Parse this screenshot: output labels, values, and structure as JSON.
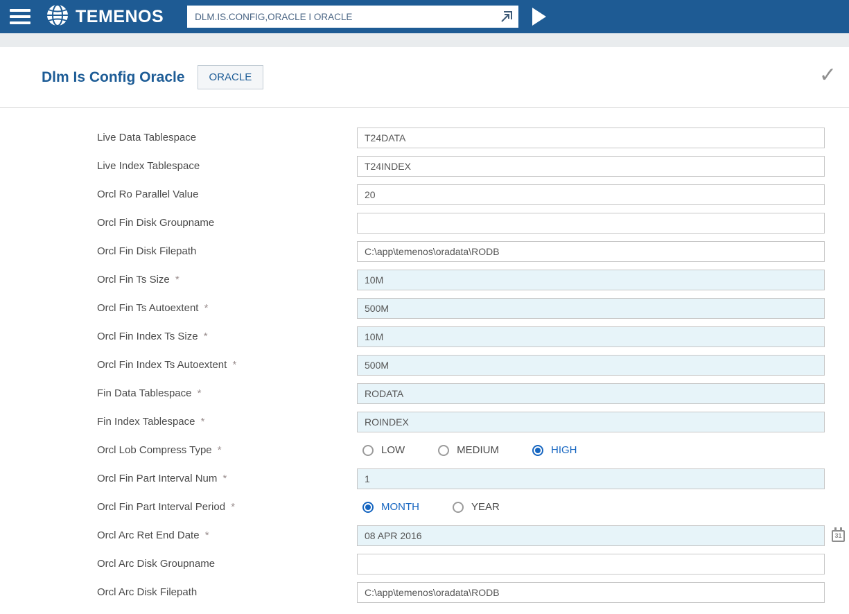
{
  "topbar": {
    "brand": "TEMENOS",
    "command": {
      "value": "DLM.IS.CONFIG,ORACLE I ORACLE"
    }
  },
  "page": {
    "title": "Dlm Is Config Oracle",
    "badge": "ORACLE"
  },
  "icons": {
    "check": "✓",
    "calendar_day": "31"
  },
  "colors": {
    "topbar_blue": "#1e5b94",
    "title_blue": "#1d5c96",
    "radio_blue": "#1565c0",
    "required_field_bg": "#e7f4f9"
  },
  "form": {
    "fields": [
      {
        "label": "Live Data Tablespace",
        "required": false,
        "type": "text",
        "value": "T24DATA",
        "highlight": false
      },
      {
        "label": "Live Index Tablespace",
        "required": false,
        "type": "text",
        "value": "T24INDEX",
        "highlight": false
      },
      {
        "label": "Orcl Ro Parallel Value",
        "required": false,
        "type": "text",
        "value": "20",
        "highlight": false
      },
      {
        "label": "Orcl Fin Disk Groupname",
        "required": false,
        "type": "text",
        "value": "",
        "highlight": false
      },
      {
        "label": "Orcl Fin Disk Filepath",
        "required": false,
        "type": "text",
        "value": "C:\\app\\temenos\\oradata\\RODB",
        "highlight": false
      },
      {
        "label": "Orcl Fin Ts Size",
        "required": true,
        "type": "text",
        "value": "10M",
        "highlight": true
      },
      {
        "label": "Orcl Fin Ts Autoextent",
        "required": true,
        "type": "text",
        "value": "500M",
        "highlight": true
      },
      {
        "label": "Orcl Fin Index Ts Size",
        "required": true,
        "type": "text",
        "value": "10M",
        "highlight": true
      },
      {
        "label": "Orcl Fin Index Ts Autoextent",
        "required": true,
        "type": "text",
        "value": "500M",
        "highlight": true
      },
      {
        "label": "Fin Data Tablespace",
        "required": true,
        "type": "text",
        "value": "RODATA",
        "highlight": true
      },
      {
        "label": "Fin Index Tablespace",
        "required": true,
        "type": "text",
        "value": "ROINDEX",
        "highlight": true
      },
      {
        "label": "Orcl Lob Compress Type",
        "required": true,
        "type": "radio",
        "options": [
          {
            "label": "LOW",
            "selected": false
          },
          {
            "label": "MEDIUM",
            "selected": false
          },
          {
            "label": "HIGH",
            "selected": true
          }
        ]
      },
      {
        "label": "Orcl Fin Part Interval Num",
        "required": true,
        "type": "text",
        "value": "1",
        "highlight": true
      },
      {
        "label": "Orcl Fin Part Interval Period",
        "required": true,
        "type": "radio",
        "options": [
          {
            "label": "MONTH",
            "selected": true
          },
          {
            "label": "YEAR",
            "selected": false
          }
        ]
      },
      {
        "label": "Orcl Arc Ret End Date",
        "required": true,
        "type": "text",
        "value": "08 APR 2016",
        "highlight": true,
        "calendar": true
      },
      {
        "label": "Orcl Arc Disk Groupname",
        "required": false,
        "type": "text",
        "value": "",
        "highlight": false
      },
      {
        "label": "Orcl Arc Disk Filepath",
        "required": false,
        "type": "text",
        "value": "C:\\app\\temenos\\oradata\\RODB",
        "highlight": false
      }
    ]
  }
}
